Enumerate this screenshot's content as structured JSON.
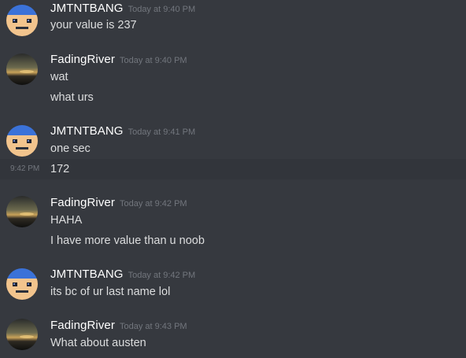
{
  "users": {
    "jmt": {
      "name": "JMTNTBANG",
      "avatar": "pixel-face-blue-cap-avatar"
    },
    "fr": {
      "name": "FadingRiver",
      "avatar": "sunset-landscape-avatar"
    }
  },
  "colors": {
    "background": "#36393f",
    "hover_row": "#32353b",
    "username": "#ffffff",
    "message_text": "#dcddde",
    "timestamp": "#72767d"
  },
  "messages": [
    {
      "author": "JMTNTBANG",
      "timestamp": "Today at 9:40 PM",
      "lines": [
        "your value is 237"
      ]
    },
    {
      "author": "FadingRiver",
      "timestamp": "Today at 9:40 PM",
      "lines": [
        "wat",
        "what urs"
      ]
    },
    {
      "author": "JMTNTBANG",
      "timestamp": "Today at 9:41 PM",
      "lines": [
        "one sec"
      ],
      "hovered_line": {
        "time": "9:42 PM",
        "text": "172"
      }
    },
    {
      "author": "FadingRiver",
      "timestamp": "Today at 9:42 PM",
      "lines": [
        "HAHA",
        "I have more value than u noob"
      ]
    },
    {
      "author": "JMTNTBANG",
      "timestamp": "Today at 9:42 PM",
      "lines": [
        "its bc of ur last name lol"
      ]
    },
    {
      "author": "FadingRiver",
      "timestamp": "Today at 9:43 PM",
      "lines": [
        "What about austen"
      ]
    }
  ]
}
